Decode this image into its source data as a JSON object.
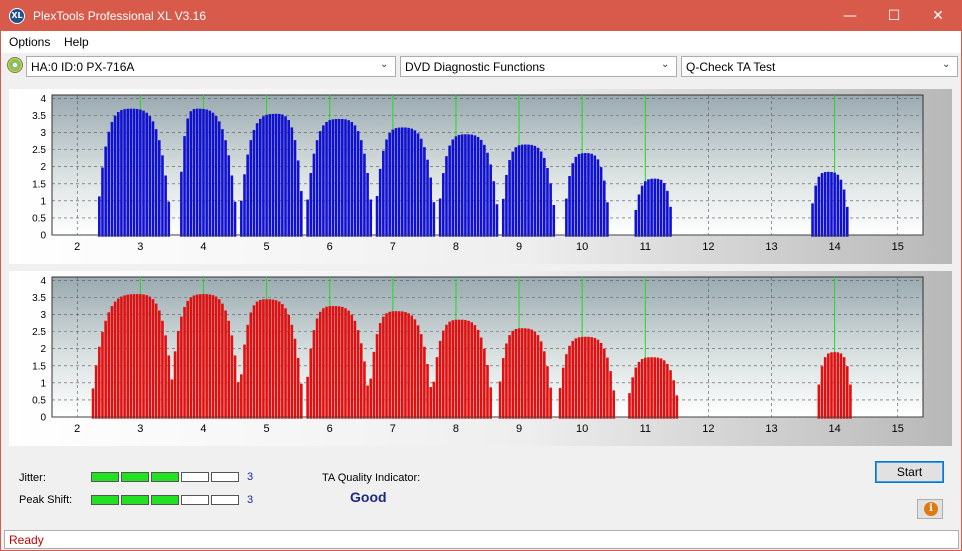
{
  "window": {
    "title": "PlexTools Professional XL V3.16",
    "icon_label": "XL",
    "title_bar_color": "#d75a4a",
    "controls": {
      "minimize": "—",
      "maximize": "☐",
      "close": "✕"
    }
  },
  "menu": {
    "items": [
      "Options",
      "Help"
    ]
  },
  "toolbar": {
    "drive": "HA:0 ID:0  PX-716A",
    "function": "DVD Diagnostic Functions",
    "test": "Q-Check TA Test"
  },
  "charts": {
    "x_ticks": [
      "2",
      "3",
      "4",
      "5",
      "6",
      "7",
      "8",
      "9",
      "10",
      "11",
      "12",
      "13",
      "14",
      "15"
    ],
    "y_ticks": [
      "0",
      "0.5",
      "1",
      "1.5",
      "2",
      "2.5",
      "3",
      "3.5",
      "4"
    ],
    "green_marker_color": "#22dd22"
  },
  "chart_data": [
    {
      "type": "bar",
      "color": "#1010d0",
      "x_range": [
        1.6,
        15.4
      ],
      "ylim": [
        0,
        4.1
      ],
      "grid": true,
      "green_markers": [
        3,
        4,
        5,
        6,
        7,
        8,
        9,
        10,
        11,
        14
      ],
      "peaks": [
        {
          "center": 2.85,
          "height": 3.7,
          "start": 2.3,
          "end": 3.5
        },
        {
          "center": 3.9,
          "height": 3.7,
          "start": 3.6,
          "end": 4.55
        },
        {
          "center": 5.15,
          "height": 3.55,
          "start": 4.55,
          "end": 5.6
        },
        {
          "center": 6.15,
          "height": 3.4,
          "start": 5.6,
          "end": 6.7
        },
        {
          "center": 7.15,
          "height": 3.15,
          "start": 6.7,
          "end": 7.7
        },
        {
          "center": 8.15,
          "height": 2.95,
          "start": 7.7,
          "end": 8.7
        },
        {
          "center": 9.1,
          "height": 2.65,
          "start": 8.7,
          "end": 9.6
        },
        {
          "center": 10.05,
          "height": 2.4,
          "start": 9.7,
          "end": 10.45
        },
        {
          "center": 11.15,
          "height": 1.65,
          "start": 10.8,
          "end": 11.45
        },
        {
          "center": 13.9,
          "height": 1.85,
          "start": 13.6,
          "end": 14.25
        }
      ]
    },
    {
      "type": "bar",
      "color": "#e01010",
      "x_range": [
        1.6,
        15.4
      ],
      "ylim": [
        0,
        4.1
      ],
      "grid": true,
      "green_markers": [
        3,
        4,
        5,
        6,
        7,
        8,
        9,
        10,
        11,
        14
      ],
      "peaks": [
        {
          "center": 2.95,
          "height": 3.6,
          "start": 2.2,
          "end": 3.55
        },
        {
          "center": 4.0,
          "height": 3.6,
          "start": 3.45,
          "end": 4.6
        },
        {
          "center": 5.0,
          "height": 3.45,
          "start": 4.55,
          "end": 5.6
        },
        {
          "center": 6.05,
          "height": 3.25,
          "start": 5.6,
          "end": 6.65
        },
        {
          "center": 7.05,
          "height": 3.1,
          "start": 6.6,
          "end": 7.65
        },
        {
          "center": 8.05,
          "height": 2.85,
          "start": 7.6,
          "end": 8.6
        },
        {
          "center": 9.05,
          "height": 2.6,
          "start": 8.65,
          "end": 9.55
        },
        {
          "center": 10.05,
          "height": 2.35,
          "start": 9.6,
          "end": 10.55
        },
        {
          "center": 11.1,
          "height": 1.75,
          "start": 10.7,
          "end": 11.55
        },
        {
          "center": 14.0,
          "height": 1.9,
          "start": 13.7,
          "end": 14.3
        }
      ]
    }
  ],
  "metrics": {
    "jitter": {
      "label": "Jitter:",
      "value": "3",
      "level": 3,
      "max": 5
    },
    "peak_shift": {
      "label": "Peak Shift:",
      "value": "3",
      "level": 3,
      "max": 5
    }
  },
  "ta_quality": {
    "label": "TA Quality Indicator:",
    "value": "Good"
  },
  "buttons": {
    "start": "Start",
    "info_icon": "i"
  },
  "status": {
    "text": "Ready"
  }
}
